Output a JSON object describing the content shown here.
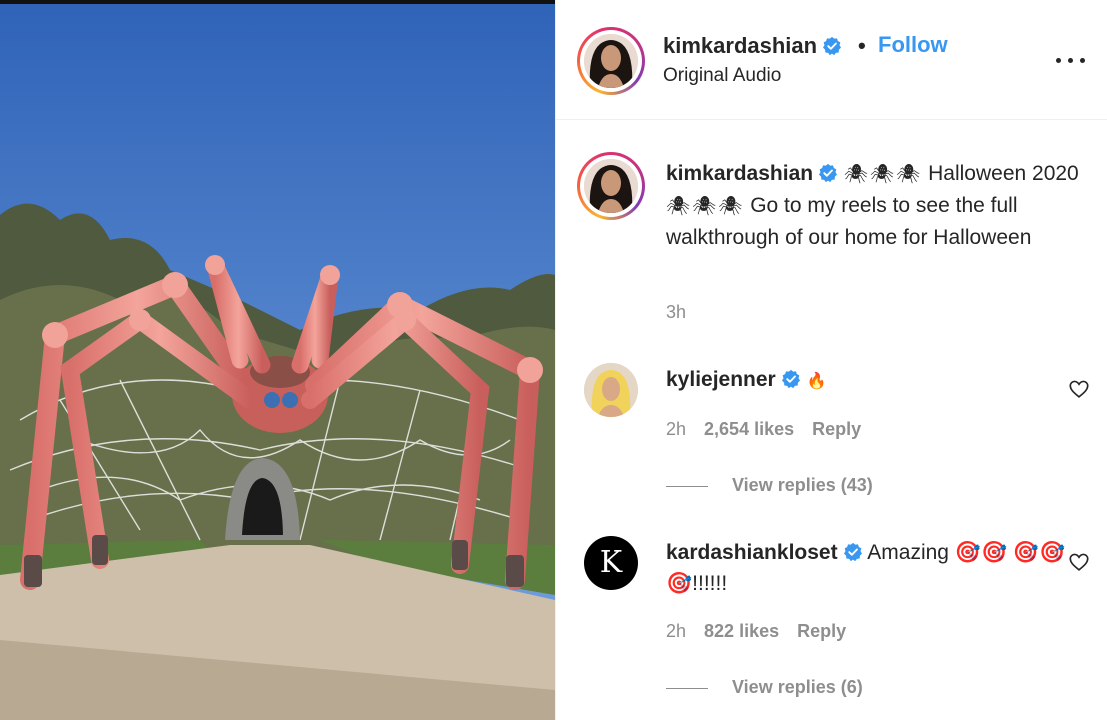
{
  "post": {
    "username": "kimkardashian",
    "follow_label": "Follow",
    "separator": "•",
    "audio": "Original Audio",
    "more_label": "More options"
  },
  "caption": {
    "username": "kimkardashian",
    "spiders1": "🕷🕷🕷",
    "text1": " Halloween 2020 ",
    "spiders2": "🕷🕷🕷",
    "text2": " Go to my reels to see the full walkthrough of our home for Halloween",
    "time": "3h"
  },
  "comments": [
    {
      "username": "kyliejenner",
      "text": "🔥",
      "time": "2h",
      "likes": "2,654 likes",
      "reply_label": "Reply",
      "view_replies": "View replies (43)"
    },
    {
      "username": "kardashiankloset",
      "avatar_letter": "K",
      "text": " Amazing 🎯🎯 🎯🎯🎯!!!!!!",
      "time": "2h",
      "likes": "822 likes",
      "reply_label": "Reply",
      "view_replies": "View replies (6)"
    }
  ],
  "colors": {
    "follow": "#3897f0",
    "verified": "#3897f0",
    "muted": "#8e8e8e",
    "sky": "#3f76c8",
    "spider": "#e88a84"
  },
  "icons": [
    "verified-badge-icon",
    "more-options-icon",
    "heart-icon",
    "spider-emoji",
    "fire-emoji",
    "target-emoji"
  ]
}
